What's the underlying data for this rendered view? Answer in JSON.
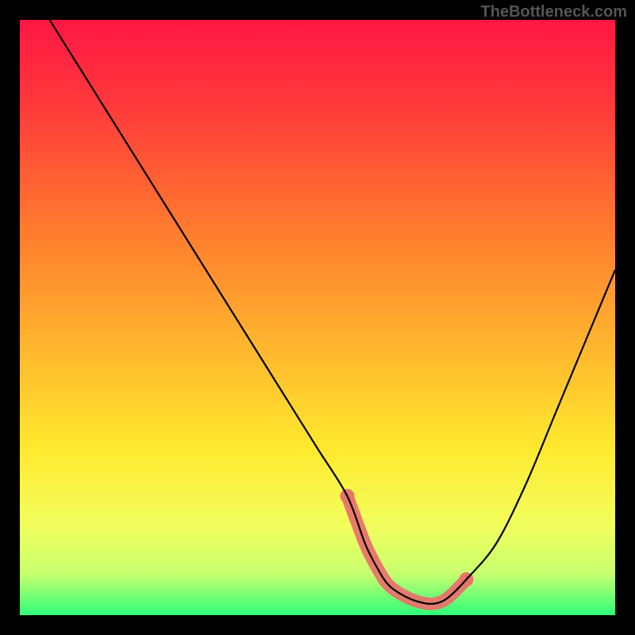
{
  "watermark": "TheBottleneck.com",
  "chart_data": {
    "type": "line",
    "title": "",
    "xlabel": "",
    "ylabel": "",
    "xlim": [
      0,
      100
    ],
    "ylim": [
      0,
      100
    ],
    "series": [
      {
        "name": "curve",
        "x": [
          5,
          10,
          15,
          20,
          25,
          30,
          35,
          40,
          45,
          50,
          55,
          58,
          60,
          62,
          65,
          68,
          70,
          72,
          75,
          80,
          85,
          90,
          95,
          100
        ],
        "y": [
          100,
          92,
          84,
          76,
          68,
          60,
          52,
          44,
          36,
          28,
          20,
          12,
          8,
          5,
          3,
          2,
          2,
          3,
          6,
          12,
          22,
          34,
          46,
          58
        ]
      }
    ],
    "highlight_region": {
      "x_start": 56,
      "x_end": 73,
      "color": "#e8736b"
    },
    "gradient_stops": [
      {
        "offset": 0,
        "color": "#ff1744"
      },
      {
        "offset": 0.15,
        "color": "#ff3b3b"
      },
      {
        "offset": 0.35,
        "color": "#ff7a2e"
      },
      {
        "offset": 0.55,
        "color": "#ffb62e"
      },
      {
        "offset": 0.72,
        "color": "#ffe92e"
      },
      {
        "offset": 0.85,
        "color": "#f2ff5e"
      },
      {
        "offset": 0.93,
        "color": "#c8ff6e"
      },
      {
        "offset": 1.0,
        "color": "#2eff7a"
      }
    ]
  }
}
